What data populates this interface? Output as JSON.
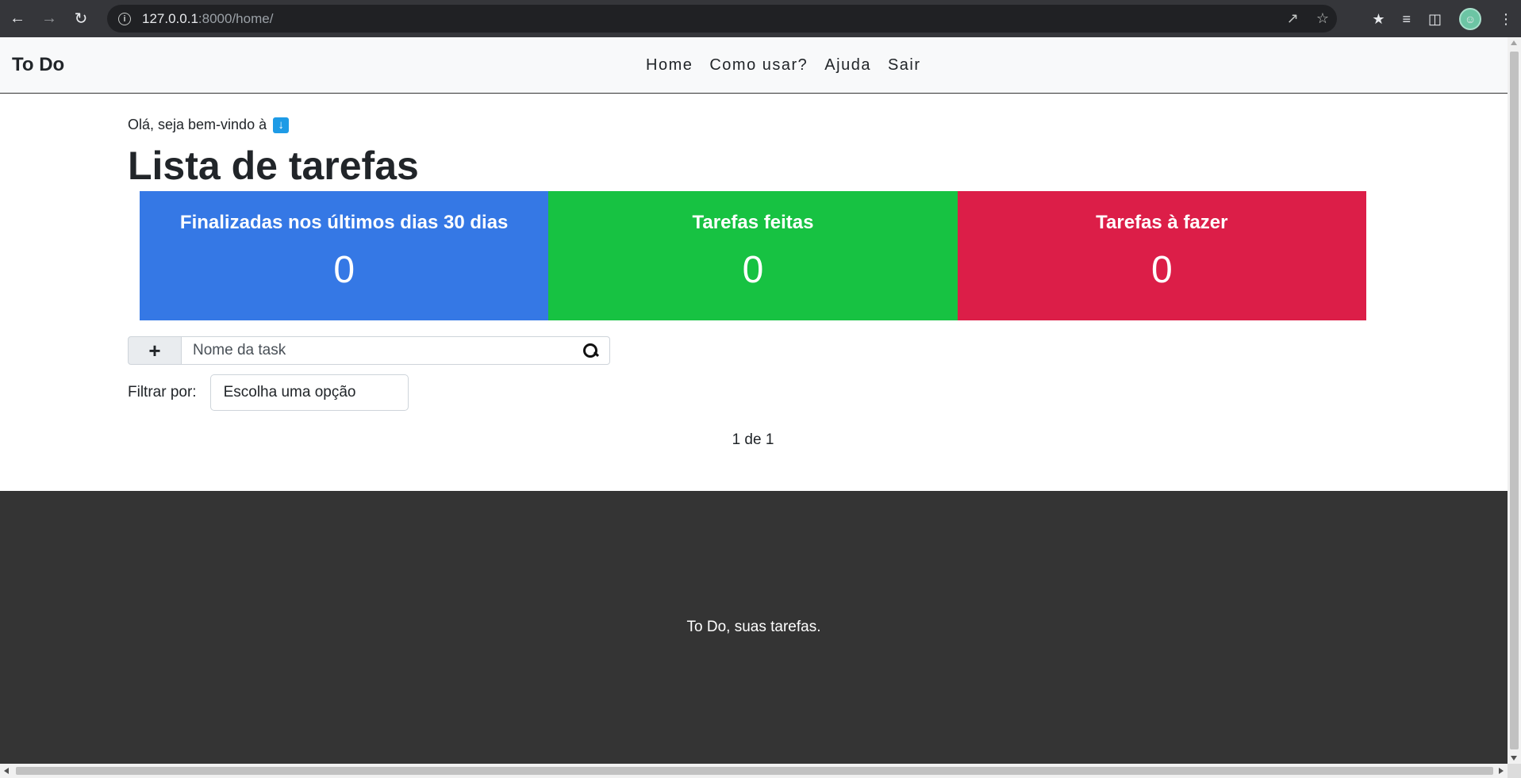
{
  "browser": {
    "url_host": "127.0.0.1",
    "url_rest": ":8000/home/"
  },
  "navbar": {
    "brand": "To Do",
    "links": [
      "Home",
      "Como usar?",
      "Ajuda",
      "Sair"
    ]
  },
  "main": {
    "welcome": "Olá, seja bem-vindo à",
    "title": "Lista de tarefas",
    "cards": [
      {
        "title": "Finalizadas nos últimos dias 30 dias",
        "value": "0",
        "color": "#3578e5"
      },
      {
        "title": "Tarefas feitas",
        "value": "0",
        "color": "#17c242"
      },
      {
        "title": "Tarefas à fazer",
        "value": "0",
        "color": "#dc1e48"
      }
    ],
    "add_button_label": "+",
    "search_placeholder": "Nome da task",
    "filter_label": "Filtrar por:",
    "filter_selected": "Escolha uma opção",
    "pagination": "1 de 1"
  },
  "footer": {
    "text": "To Do, suas tarefas."
  },
  "icons": {
    "back": "back-arrow-icon",
    "forward": "forward-arrow-icon",
    "reload": "reload-icon",
    "info": "info-icon",
    "share": "share-icon",
    "star": "star-icon",
    "extensions": "puzzle-icon",
    "reading_list": "reading-list-icon",
    "side_panel": "side-panel-icon",
    "profile": "avatar",
    "menu": "kebab-menu-icon",
    "welcome_arrow": "down-arrow-icon",
    "search": "search-icon"
  }
}
